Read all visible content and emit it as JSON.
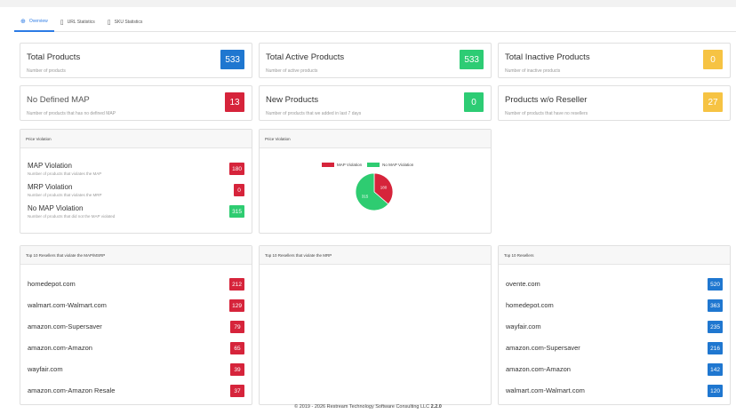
{
  "tabs": [
    {
      "label": "Overview",
      "icon": "grid-icon"
    },
    {
      "label": "URL Statistics",
      "icon": "document-icon"
    },
    {
      "label": "SKU Statistics",
      "icon": "barcode-icon"
    }
  ],
  "stats": [
    {
      "title": "Total Products",
      "sub": "Number of products",
      "value": "533",
      "color": "#1f77d0"
    },
    {
      "title": "Total Active Products",
      "sub": "Number of active products",
      "value": "533",
      "color": "#2dcc74"
    },
    {
      "title": "Total Inactive Products",
      "sub": "Number of inactive products",
      "value": "0",
      "color": "#f6c343"
    },
    {
      "title": "No Defined MAP",
      "sub": "Number of products that has no defined MAP",
      "value": "13",
      "color": "#d6243b"
    },
    {
      "title": "New Products",
      "sub": "Number of products that we added in last 7 days",
      "value": "0",
      "color": "#2dcc74"
    },
    {
      "title": "Products w/o Reseller",
      "sub": "Number of products that have no resellers",
      "value": "27",
      "color": "#f6c343"
    }
  ],
  "price_violation": {
    "header": "Price Violation",
    "items": [
      {
        "title": "MAP Violation",
        "sub": "Number of products that violates the MAP",
        "value": "180"
      },
      {
        "title": "MRP Violation",
        "sub": "Number of products that violates the MRP",
        "value": "0"
      },
      {
        "title": "No MAP Violation",
        "sub": "Number of products that did not the MAP violated",
        "value": "315"
      }
    ]
  },
  "chart_panel": {
    "header": "Price Violation",
    "legend": [
      "MAP Violation",
      "No MAP Violation"
    ]
  },
  "chart_data": {
    "type": "pie",
    "categories": [
      "MAP Violation",
      "No MAP Violation"
    ],
    "values": [
      180,
      315
    ],
    "colors": [
      "#d6243b",
      "#2ecc71"
    ],
    "title": "",
    "legend": "top"
  },
  "top_violators": {
    "header": "Top 10 Resellers that violate the MAP/MSRP",
    "rows": [
      {
        "name": "homedepot.com",
        "value": "212"
      },
      {
        "name": "walmart.com-Walmart.com",
        "value": "129"
      },
      {
        "name": "amazon.com-Supersaver",
        "value": "79"
      },
      {
        "name": "amazon.com-Amazon",
        "value": "65"
      },
      {
        "name": "wayfair.com",
        "value": "39"
      },
      {
        "name": "amazon.com-Amazon Resale",
        "value": "37"
      }
    ]
  },
  "top_mrp": {
    "header": "Top 10 Resellers that violate the MRP"
  },
  "top_resellers": {
    "header": "Top 10 Resellers",
    "rows": [
      {
        "name": "ovente.com",
        "value": "520"
      },
      {
        "name": "homedepot.com",
        "value": "363"
      },
      {
        "name": "wayfair.com",
        "value": "235"
      },
      {
        "name": "amazon.com-Supersaver",
        "value": "216"
      },
      {
        "name": "amazon.com-Amazon",
        "value": "142"
      },
      {
        "name": "walmart.com-Walmart.com",
        "value": "120"
      }
    ]
  },
  "footer": {
    "text": "© 2019 - 2026 Restream Technology Software Consulting LLC",
    "version": "2.2.0"
  }
}
